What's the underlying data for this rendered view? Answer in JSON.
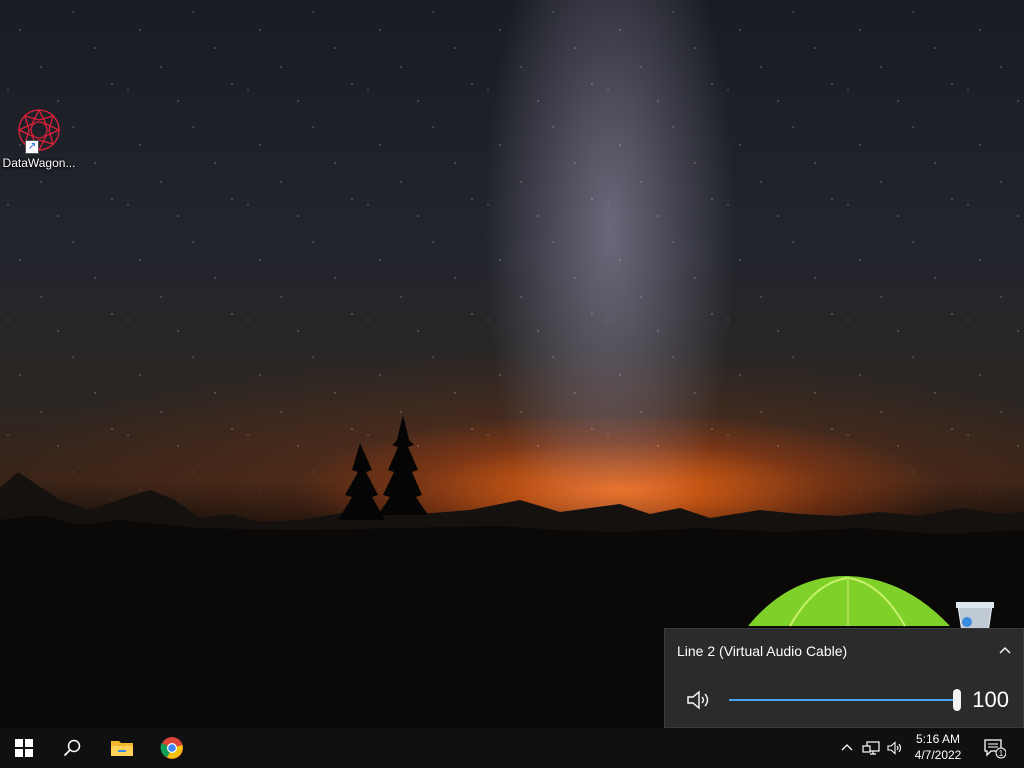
{
  "desktop": {
    "icons": [
      {
        "label": "DataWagon...",
        "icon": "datawagon-icon"
      }
    ]
  },
  "volume_flyout": {
    "device_name": "Line 2 (Virtual Audio Cable)",
    "volume": 100,
    "volume_text": "100",
    "accent": "#4aa3f0"
  },
  "taskbar": {
    "apps": [
      "start-icon",
      "search-icon",
      "file-explorer-icon",
      "chrome-icon"
    ],
    "tray_icons": [
      "chevron-up-icon",
      "network-icon",
      "speaker-icon"
    ],
    "time": "5:16 AM",
    "date": "4/7/2022",
    "notification_count": "1"
  }
}
